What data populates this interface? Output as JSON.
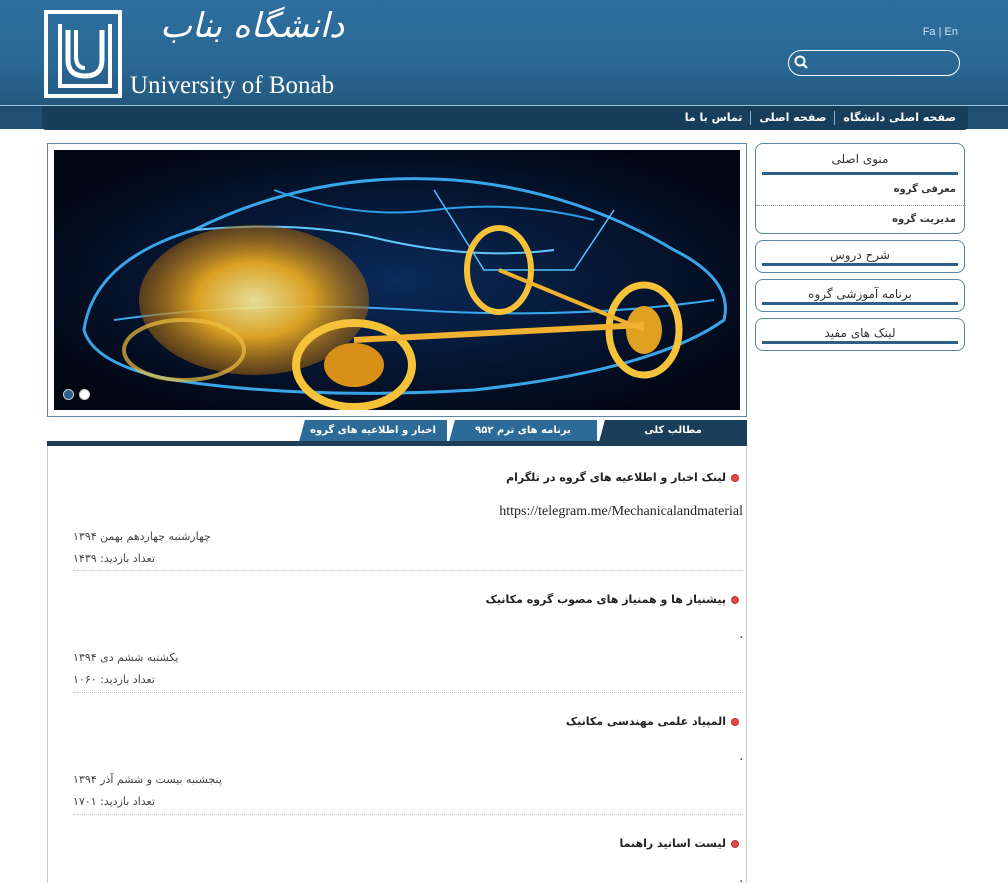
{
  "header": {
    "logo_fa": "دانشگاه بناب",
    "logo_en": "University of Bonab",
    "lang_fa": "Fa",
    "lang_sep": "|",
    "lang_en": "En",
    "search_placeholder": ""
  },
  "nav": {
    "items": [
      "صفحه اصلی دانشگاه",
      "صفحه اصلی",
      "تماس با ما"
    ]
  },
  "tabs": [
    "مطالب کلی",
    "برنامه های ترم ۹۵۲",
    "اخبار و اطلاعیه های گروه"
  ],
  "news": [
    {
      "title": "لینک اخبار و اطلاعیه های گروه در تلگرام",
      "body": "https://telegram.me/Mechanicalandmaterial",
      "date": "چهارشنبه چهاردهم بهمن ۱۳۹۴",
      "views": "تعداد بازدید: ۱۴۳۹"
    },
    {
      "title": "پیشنیاز ها و همنیاز های مصوب گروه مکانیک",
      "body": ".",
      "date": "یکشنبه ششم دی ۱۳۹۴",
      "views": "تعداد بازدید: ۱۰۶۰"
    },
    {
      "title": "المپیاد علمی مهندسی مکانیک",
      "body": ".",
      "date": "پنجشنبه بیست و ششم آذر ۱۳۹۴",
      "views": "تعداد بازدید: ۱۷۰۱"
    },
    {
      "title": "لیست اساتید راهنما",
      "body": ".",
      "date": "",
      "views": ""
    }
  ],
  "sidebar": {
    "main_menu": {
      "title": "منوی اصلی",
      "items": [
        "معرفی گروه",
        "مدیریت گروه"
      ]
    },
    "boxes": [
      "شرح دروس",
      "برنامه آموزشی گروه",
      "لینک های مفید"
    ]
  },
  "colors": {
    "header": "#2a6894",
    "navbar": "#173f5c",
    "tab": "#2c6a98",
    "tab_active": "#1b3f5a",
    "bullet": "#e24848"
  }
}
